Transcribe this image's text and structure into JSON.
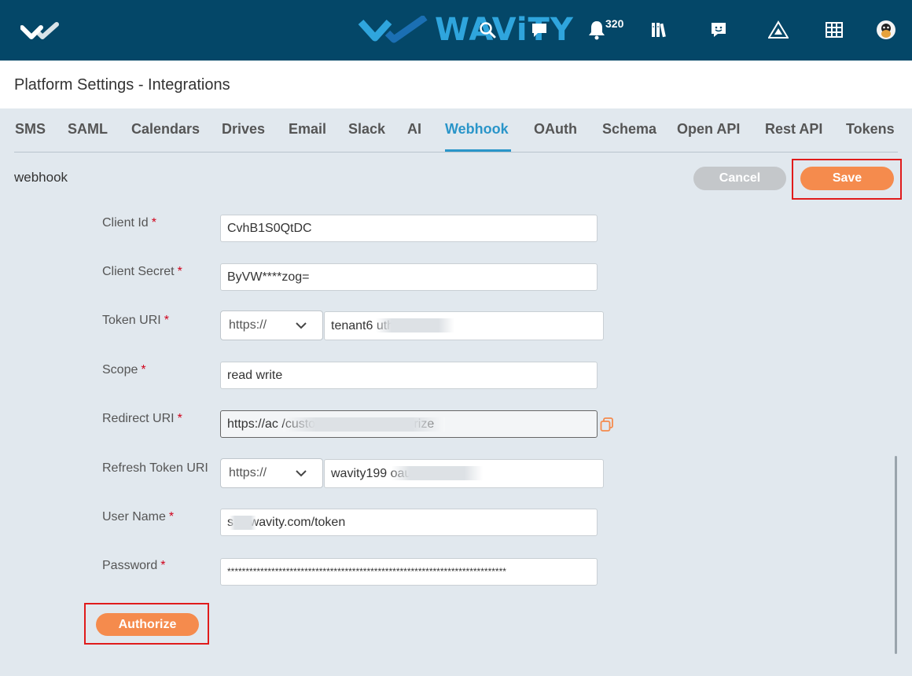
{
  "header": {
    "brand_name": "WAViTY",
    "notification_count": "320",
    "icons": [
      "logo-check-icon",
      "search-icon",
      "chat-icon",
      "bell-icon",
      "library-icon",
      "message-icon",
      "alert-triangle-icon",
      "grid-icon",
      "avatar"
    ]
  },
  "page": {
    "title": "Platform Settings - Integrations"
  },
  "tabs": [
    {
      "label": "SMS"
    },
    {
      "label": "SAML"
    },
    {
      "label": "Calendars"
    },
    {
      "label": "Drives"
    },
    {
      "label": "Email"
    },
    {
      "label": "Slack"
    },
    {
      "label": "AI"
    },
    {
      "label": "Webhook",
      "active": true
    },
    {
      "label": "OAuth"
    },
    {
      "label": "Schema"
    },
    {
      "label": "Open API"
    },
    {
      "label": "Rest API"
    },
    {
      "label": "Tokens"
    }
  ],
  "section": {
    "label": "webhook"
  },
  "actions": {
    "cancel": "Cancel",
    "save": "Save",
    "authorize": "Authorize"
  },
  "form": {
    "client_id": {
      "label": "Client Id",
      "required": "*",
      "value": "CvhB1S0QtDC"
    },
    "client_secret": {
      "label": "Client Secret",
      "required": "*",
      "value": "ByVW****zog="
    },
    "token_uri": {
      "label": "Token URI",
      "required": "*",
      "scheme": "https://",
      "value": "tenant6                      uth/token"
    },
    "scope": {
      "label": "Scope",
      "required": "*",
      "value": "read write"
    },
    "redirect_uri": {
      "label": "Redirect URI",
      "required": "*",
      "value": "https://ac                                                    /customer/shared/authorize"
    },
    "refresh_token_uri": {
      "label": "Refresh Token URI",
      "scheme": "https://",
      "value": "wavity199                             oauth/tokens"
    },
    "user_name": {
      "label": "User Name",
      "required": "*",
      "value": "s        @wavity.com/token"
    },
    "password": {
      "label": "Password",
      "required": "*",
      "value": "****************************************************************************"
    }
  },
  "colors": {
    "topbar": "#044768",
    "accent": "#2a95c9",
    "primary_button": "#f58b4d",
    "cancel_button": "#c4c7ca",
    "highlight": "#e01b1b",
    "background": "#e1e8ee"
  }
}
